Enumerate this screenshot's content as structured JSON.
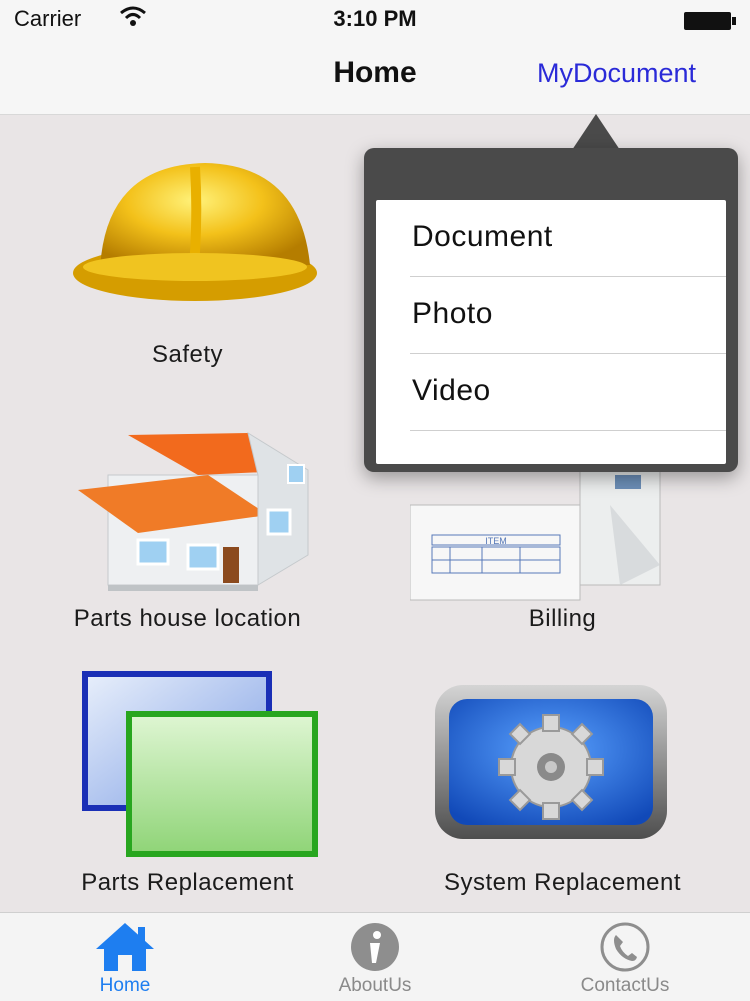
{
  "status_bar": {
    "carrier": "Carrier",
    "time": "3:10 PM"
  },
  "nav": {
    "title": "Home",
    "right_button": "MyDocument"
  },
  "grid": {
    "items": [
      {
        "label": "Safety",
        "icon": "hard-hat-icon"
      },
      {
        "label": "",
        "icon": "hidden-icon"
      },
      {
        "label": "Parts house location",
        "icon": "house-icon"
      },
      {
        "label": "Billing",
        "icon": "invoice-icon"
      },
      {
        "label": "Parts Replacement",
        "icon": "overlapping-squares-icon"
      },
      {
        "label": "System Replacement",
        "icon": "gear-icon"
      }
    ]
  },
  "popover": {
    "items": [
      {
        "label": "Document"
      },
      {
        "label": "Photo"
      },
      {
        "label": "Video"
      }
    ]
  },
  "tabs": [
    {
      "label": "Home",
      "icon": "home-icon",
      "active": true
    },
    {
      "label": "AboutUs",
      "icon": "info-icon",
      "active": false
    },
    {
      "label": "ContactUs",
      "icon": "phone-icon",
      "active": false
    }
  ],
  "colors": {
    "accent": "#1e7ef0",
    "nav_link": "#2a2ad8",
    "popover_bg": "#4a4a4a",
    "background": "#e9e5e6"
  }
}
